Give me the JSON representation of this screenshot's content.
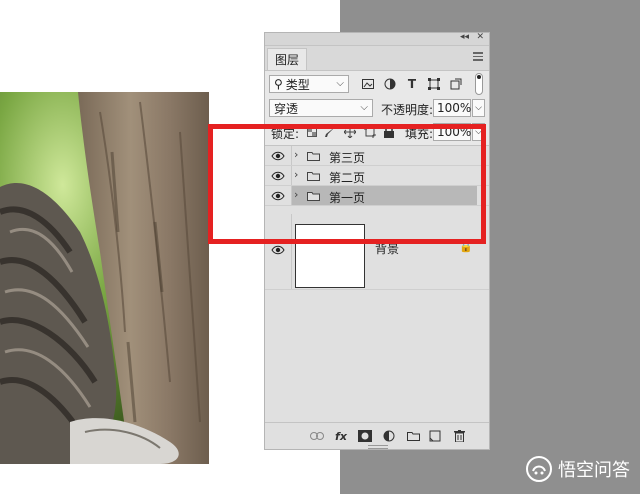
{
  "panel": {
    "tab_label": "图层",
    "collapse_glyph": "◂◂",
    "close_glyph": "✕",
    "filter": {
      "kind_label": "类型",
      "search_glyph": "⚲",
      "arrow_glyph": "⌵"
    },
    "blend": {
      "mode_label": "穿透",
      "opacity_label": "不透明度:",
      "opacity_value": "100%",
      "arrow_glyph": "⌵"
    },
    "lock": {
      "label": "锁定:",
      "fill_label": "填充:",
      "fill_value": "100%",
      "arrow_glyph": "⌵"
    }
  },
  "layers": [
    {
      "name": "第三页",
      "type": "group",
      "selected": false,
      "visible": true
    },
    {
      "name": "第二页",
      "type": "group",
      "selected": false,
      "visible": true
    },
    {
      "name": "第一页",
      "type": "group",
      "selected": true,
      "visible": true
    }
  ],
  "background_layer": {
    "name": "背景",
    "lock_glyph": "🔒"
  },
  "bottom_toolbar": {
    "fx_label": "fx"
  },
  "watermark": {
    "text": "悟空问答"
  },
  "colors": {
    "highlight_red": "#e52121",
    "panel_bg": "#e8e8e8",
    "selected_layer": "#b8b8b8"
  }
}
